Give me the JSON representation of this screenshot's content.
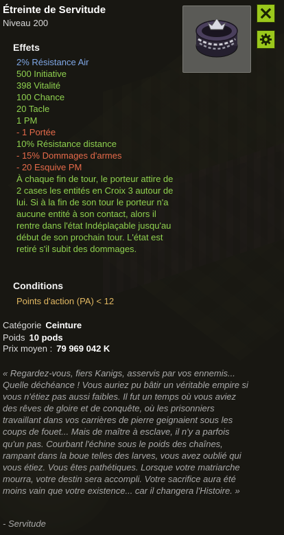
{
  "item": {
    "name": "Étreinte de Servitude",
    "level_label": "Niveau",
    "level_value": "200",
    "image_icon": "chained-belt-icon"
  },
  "buttons": {
    "close_icon": "close-icon",
    "settings_icon": "gear-icon"
  },
  "effects": {
    "heading": "Effets",
    "lines": [
      {
        "text": "2% Résistance Air",
        "color": "blue"
      },
      {
        "text": "500 Initiative",
        "color": "green"
      },
      {
        "text": "398 Vitalité",
        "color": "green"
      },
      {
        "text": "100 Chance",
        "color": "green"
      },
      {
        "text": "20 Tacle",
        "color": "green"
      },
      {
        "text": "1 PM",
        "color": "green"
      },
      {
        "text": "- 1 Portée",
        "color": "red"
      },
      {
        "text": "10% Résistance distance",
        "color": "green"
      },
      {
        "text": "- 15% Dommages d'armes",
        "color": "red"
      },
      {
        "text": "- 20 Esquive PM",
        "color": "red"
      }
    ],
    "description": "À chaque fin de tour, le porteur attire de 2 cases les entités en Croix 3 autour de lui. Si à la fin de son tour le porteur n'a aucune entité à son contact, alors il rentre dans l'état Indéplaçable jusqu'au début de son prochain tour. L'état est retiré s'il subit des dommages."
  },
  "conditions": {
    "heading": "Conditions",
    "text": "Points d'action (PA) < 12"
  },
  "meta": {
    "category_label": "Catégorie",
    "category_value": "Ceinture",
    "weight_label": "Poids",
    "weight_value": "10 pods",
    "price_label": "Prix moyen :",
    "price_value": "79 969 042 K"
  },
  "lore": {
    "text": "« Regardez-vous, fiers Kanigs, asservis par vos ennemis... Quelle déchéance ! Vous auriez pu bâtir un véritable empire si vous n'étiez pas aussi faibles. Il fut un temps où vous aviez des rêves de gloire et de conquête, où les prisonniers travaillant dans vos carrières de pierre geignaient sous les coups de fouet... Mais de maître à esclave, il n'y a parfois qu'un pas. Courbant l'échine sous le poids des chaînes, rampant dans la boue telles des larves, vous avez oublié qui vous étiez. Vous êtes pathétiques. Lorsque votre matriarche mourra, votre destin sera accompli. Votre sacrifice aura été moins vain que votre existence... car il changera l'Histoire. »",
    "signature": "- Servitude"
  },
  "colors": {
    "blue": "#7fa7e6",
    "green": "#8fd14f",
    "red": "#e56a4a",
    "condition": "#e2b862",
    "button": "#9bc81c"
  }
}
